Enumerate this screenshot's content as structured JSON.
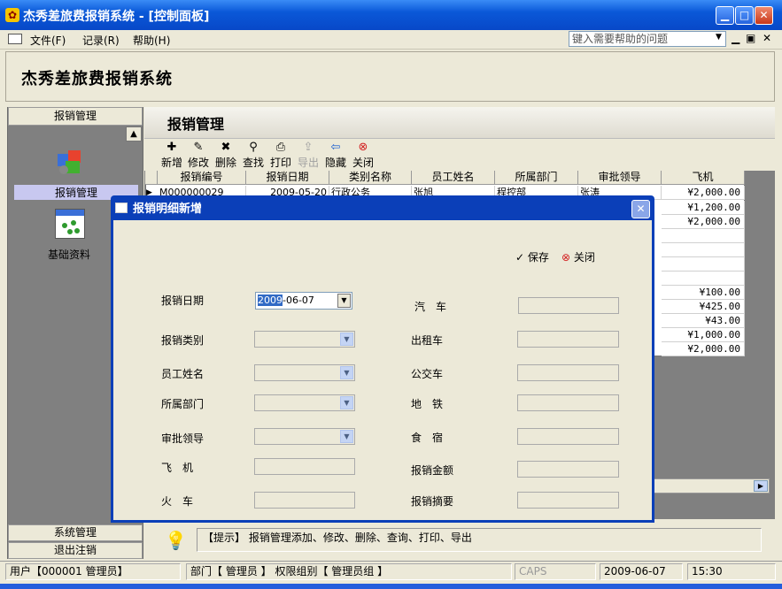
{
  "window": {
    "title": "杰秀差旅费报销系统 - [控制面板]"
  },
  "menu": {
    "items": [
      "文件(F)",
      "记录(R)",
      "帮助(H)"
    ],
    "help_placeholder": "键入需要帮助的问题"
  },
  "app": {
    "heading": "杰秀差旅费报销系统"
  },
  "sidebar": {
    "header": "报销管理",
    "items": [
      {
        "label": "报销管理",
        "icon": "gear-cubes-icon"
      },
      {
        "label": "基础资料",
        "icon": "grid-dots-icon"
      }
    ],
    "footer_items": [
      "系统管理",
      "退出注销"
    ]
  },
  "section": {
    "title": "报销管理"
  },
  "toolbar": {
    "buttons": [
      "新增",
      "修改",
      "删除",
      "查找",
      "打印",
      "导出",
      "隐藏",
      "关闭"
    ]
  },
  "grid": {
    "columns": [
      "报销编号",
      "报销日期",
      "类别名称",
      "员工姓名",
      "所属部门",
      "审批领导",
      "飞机"
    ],
    "first_row": [
      "M000000029",
      "2009-05-20",
      "行政公务",
      "张旭",
      "程控部",
      "张涛",
      "¥2,000.00"
    ],
    "plane_values": [
      "¥2,000.00",
      "¥1,200.00",
      "¥2,000.00",
      "",
      "",
      "",
      "",
      "¥100.00",
      "¥425.00",
      "¥43.00",
      "¥1,000.00",
      "¥2,000.00"
    ]
  },
  "tip": {
    "text": "【提示】 报销管理添加、修改、删除、查询、打印、导出"
  },
  "status": {
    "user": "用户【000001 管理员】",
    "dept": "部门【 管理员 】 权限组别【 管理员组 】",
    "caps": "CAPS",
    "date": "2009-06-07",
    "time": "15:30"
  },
  "dialog": {
    "title": "报销明细新增",
    "save_label": "保存",
    "close_label": "关闭",
    "date_year": "2009",
    "date_rest": "-06-07",
    "left_fields": [
      "报销日期",
      "报销类别",
      "员工姓名",
      "所属部门",
      "审批领导",
      "飞　机",
      "火　车"
    ],
    "right_fields": [
      "汽　车",
      "出租车",
      "公交车",
      "地　铁",
      "食　宿",
      "报销金额",
      "报销摘要"
    ]
  },
  "colors": {
    "title_blue": "#0a58d8",
    "dialog_blue": "#0b3fb8",
    "panel": "#ece9d8",
    "selection": "#316ac5"
  }
}
